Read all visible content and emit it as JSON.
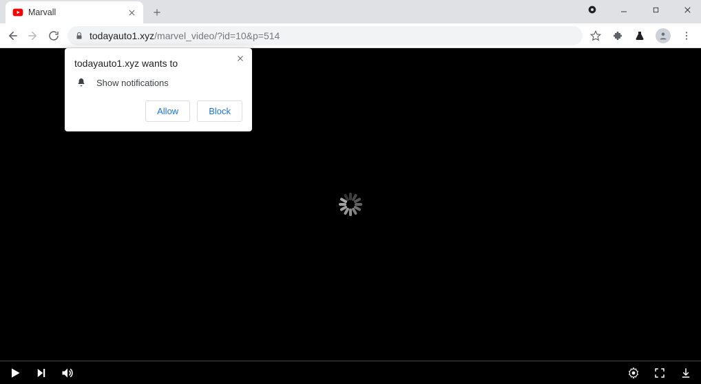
{
  "tab": {
    "title": "Marvall"
  },
  "url": {
    "domain": "todayauto1.xyz",
    "rest": "/marvel_video/?id=10&p=514"
  },
  "permission": {
    "title": "todayauto1.xyz wants to",
    "show_notifications": "Show notifications",
    "allow": "Allow",
    "block": "Block"
  }
}
